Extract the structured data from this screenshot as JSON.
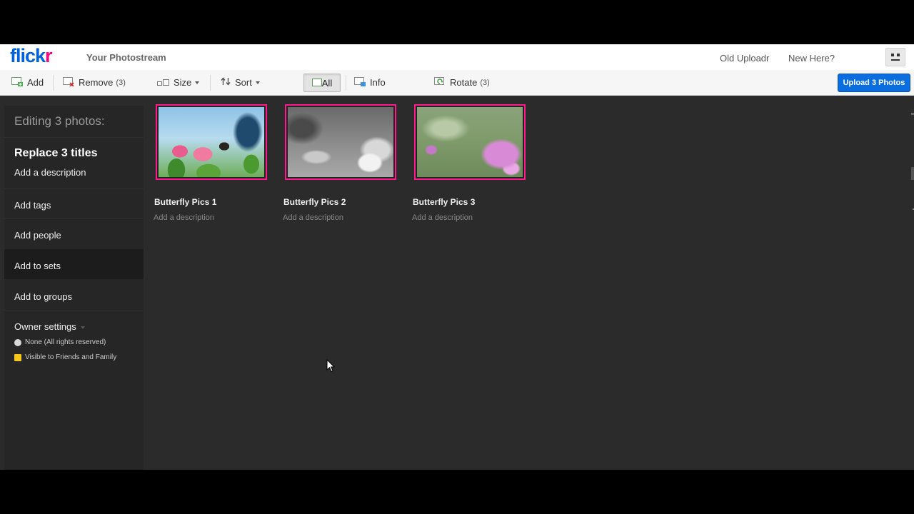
{
  "nav": {
    "logo_part1": "flick",
    "logo_part2": "r",
    "title": "Your Photostream",
    "links": [
      "Old Uploadr",
      "New Here?"
    ]
  },
  "toolbar": {
    "add": "Add",
    "remove": "Remove",
    "remove_count": "(3)",
    "size": "Size",
    "sort": "Sort",
    "all": "All",
    "info": "Info",
    "rotate": "Rotate",
    "rotate_count": "(3)",
    "upload": "Upload 3 Photos"
  },
  "sidebar": {
    "heading": "Editing 3 photos:",
    "title_action": "Replace 3 titles",
    "description_action": "Add a description",
    "items": [
      "Add tags",
      "Add people",
      "Add to sets",
      "Add to groups"
    ],
    "owner_settings": "Owner settings",
    "license": "None (All rights reserved)",
    "privacy": "Visible to Friends and Family"
  },
  "photos": [
    {
      "title": "Butterfly Pics 1",
      "description": "Add a description"
    },
    {
      "title": "Butterfly Pics 2",
      "description": "Add a description"
    },
    {
      "title": "Butterfly Pics 3",
      "description": "Add a description"
    }
  ],
  "colors": {
    "brand_blue": "#0063dc",
    "brand_pink": "#ff0084",
    "selection_border": "#ff1a8c",
    "upload_button": "#0a6de0",
    "canvas": "#2b2b2b"
  }
}
